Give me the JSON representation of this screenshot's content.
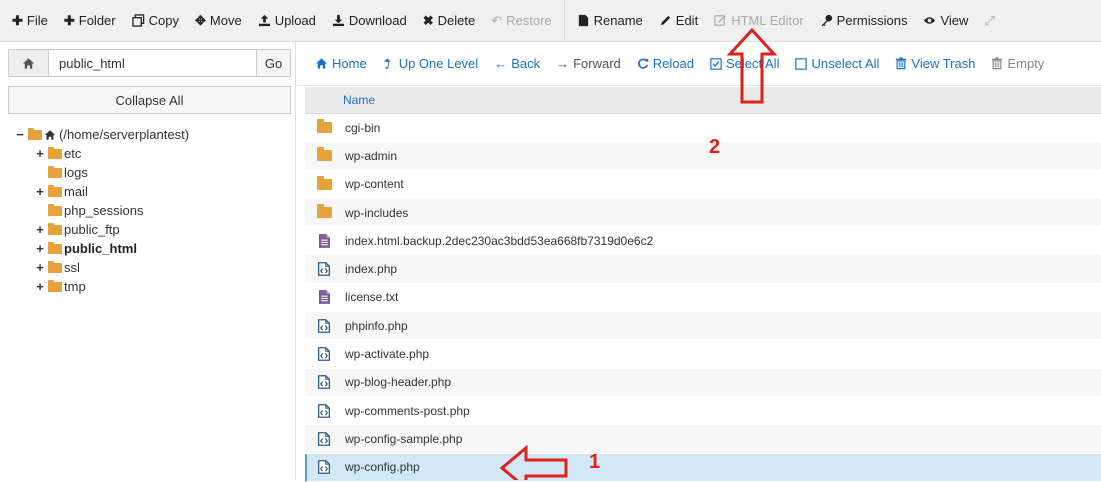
{
  "toolbar": {
    "items": [
      {
        "label": "File",
        "icon": "plus-icon"
      },
      {
        "label": "Folder",
        "icon": "plus-icon"
      },
      {
        "label": "Copy",
        "icon": "copy-icon"
      },
      {
        "label": "Move",
        "icon": "move-icon"
      },
      {
        "label": "Upload",
        "icon": "upload-icon"
      },
      {
        "label": "Download",
        "icon": "download-icon"
      },
      {
        "label": "Delete",
        "icon": "delete-icon"
      },
      {
        "label": "Restore",
        "icon": "restore-icon",
        "disabled": true
      },
      {
        "label": "Rename",
        "icon": "rename-icon"
      },
      {
        "label": "Edit",
        "icon": "pencil-icon"
      },
      {
        "label": "HTML Editor",
        "icon": "html-editor-icon",
        "disabled": true
      },
      {
        "label": "Permissions",
        "icon": "key-icon"
      },
      {
        "label": "View",
        "icon": "eye-icon"
      }
    ]
  },
  "left": {
    "path_value": "public_html",
    "go_label": "Go",
    "collapse_label": "Collapse All",
    "tree": {
      "root_label": "(/home/serverplantest)",
      "items": [
        {
          "label": "etc",
          "expandable": true
        },
        {
          "label": "logs",
          "expandable": false
        },
        {
          "label": "mail",
          "expandable": true
        },
        {
          "label": "php_sessions",
          "expandable": false
        },
        {
          "label": "public_ftp",
          "expandable": true
        },
        {
          "label": "public_html",
          "expandable": true,
          "bold": true
        },
        {
          "label": "ssl",
          "expandable": true
        },
        {
          "label": "tmp",
          "expandable": true
        }
      ]
    }
  },
  "nav": {
    "items": [
      {
        "label": "Home",
        "icon": "home-icon"
      },
      {
        "label": "Up One Level",
        "icon": "up-level-icon"
      },
      {
        "label": "Back",
        "icon": "arrow-left-icon"
      },
      {
        "label": "Forward",
        "icon": "arrow-right-icon",
        "muted": true
      },
      {
        "label": "Reload",
        "icon": "reload-icon"
      },
      {
        "label": "Select All",
        "icon": "checkbox-checked-icon"
      },
      {
        "label": "Unselect All",
        "icon": "checkbox-empty-icon"
      },
      {
        "label": "View Trash",
        "icon": "trash-icon"
      },
      {
        "label": "Empty",
        "icon": "trash-icon",
        "muted": true
      }
    ]
  },
  "table": {
    "header": "Name",
    "rows": [
      {
        "name": "cgi-bin",
        "type": "folder"
      },
      {
        "name": "wp-admin",
        "type": "folder"
      },
      {
        "name": "wp-content",
        "type": "folder"
      },
      {
        "name": "wp-includes",
        "type": "folder"
      },
      {
        "name": "index.html.backup.2dec230ac3bdd53ea668fb7319d0e6c2",
        "type": "text"
      },
      {
        "name": "index.php",
        "type": "code"
      },
      {
        "name": "license.txt",
        "type": "text"
      },
      {
        "name": "phpinfo.php",
        "type": "code"
      },
      {
        "name": "wp-activate.php",
        "type": "code"
      },
      {
        "name": "wp-blog-header.php",
        "type": "code"
      },
      {
        "name": "wp-comments-post.php",
        "type": "code"
      },
      {
        "name": "wp-config-sample.php",
        "type": "code"
      },
      {
        "name": "wp-config.php",
        "type": "code",
        "selected": true
      }
    ]
  },
  "annotations": {
    "step1": "1",
    "step2": "2",
    "color": "#e0211b"
  },
  "colors": {
    "link": "#1a73c8",
    "folder": "#e8a23a",
    "selected_row": "#d3e8f7"
  }
}
